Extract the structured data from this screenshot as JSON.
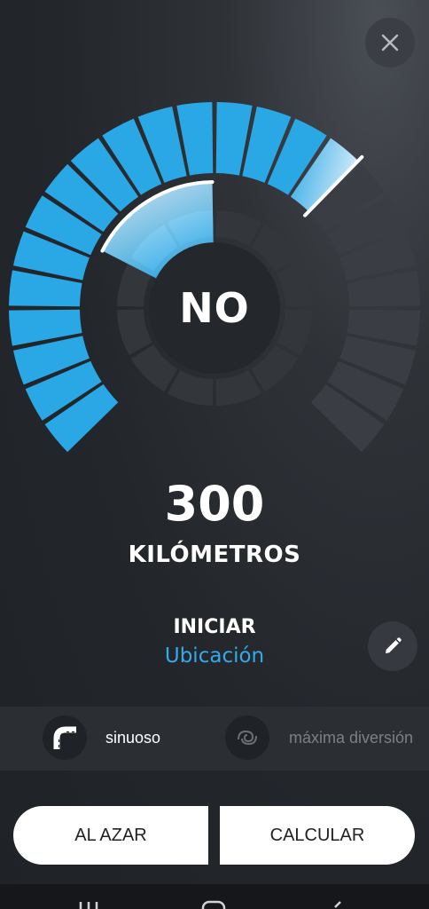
{
  "center": {
    "label": "NO"
  },
  "distance": {
    "value": "300",
    "unit": "KILÓMETROS"
  },
  "start": {
    "title": "INICIAR",
    "subtitle": "Ubicación"
  },
  "options": [
    {
      "label": "sinuoso",
      "icon": "winding-road-icon",
      "selected": true
    },
    {
      "label": "máxima diversión",
      "icon": "swirl-icon",
      "selected": false
    }
  ],
  "buttons": {
    "random": "AL AZAR",
    "calculate": "CALCULAR"
  },
  "gauge": {
    "outer_segments": 24,
    "outer_filled": 16,
    "inner_segments": 12,
    "inner_filled": 2
  },
  "colors": {
    "accent": "#2aa8e6",
    "accent_light": "#cfe9f8",
    "inactive": "#3a3e44",
    "inactive_inner": "#33373c"
  }
}
